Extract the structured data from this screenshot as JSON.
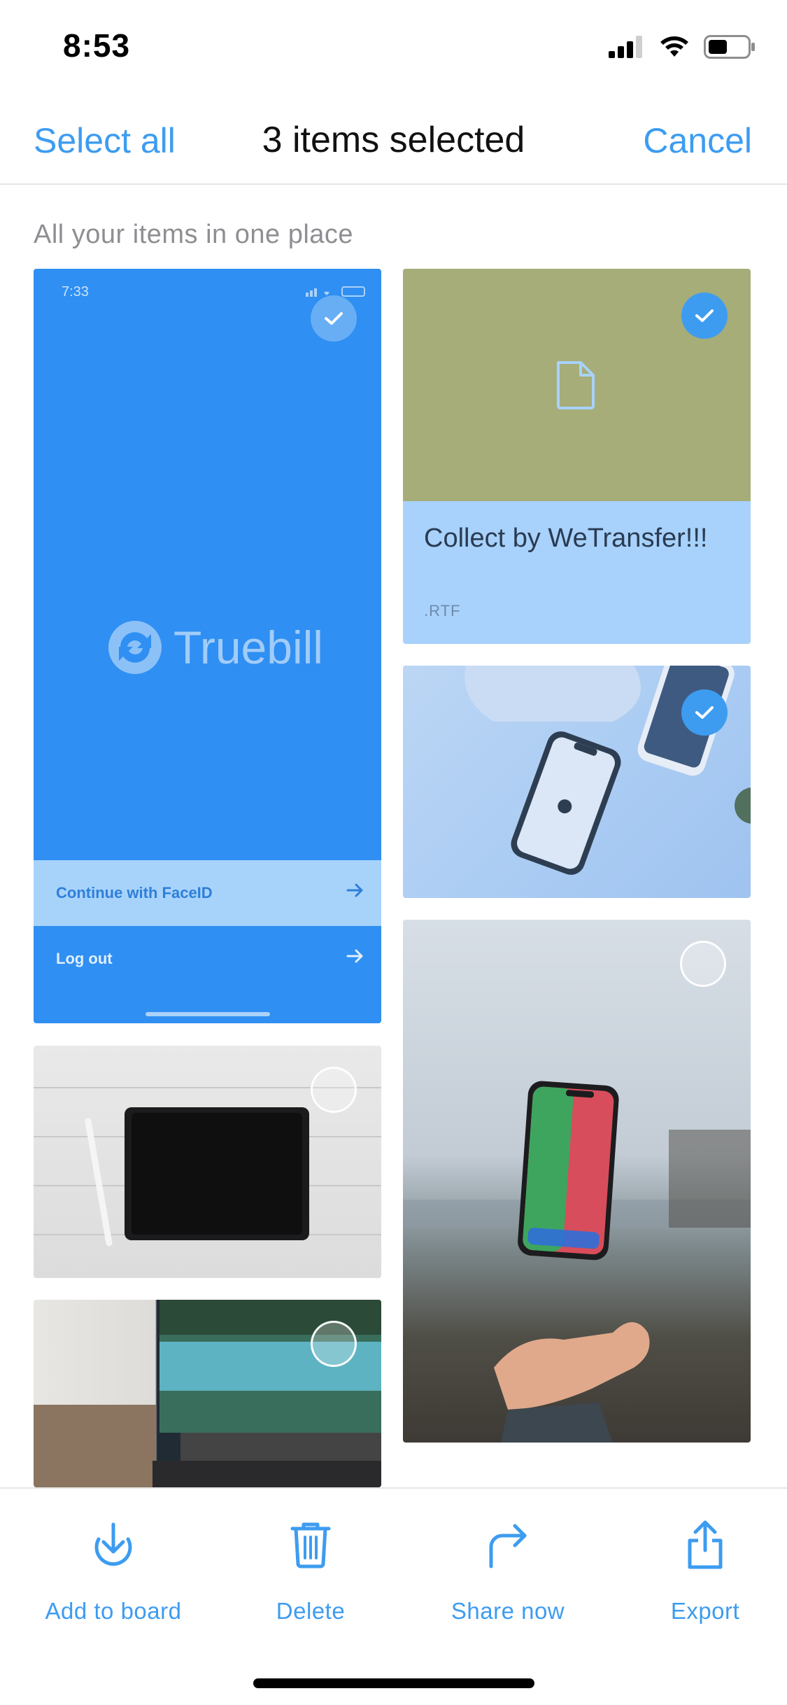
{
  "status_bar": {
    "time": "8:53"
  },
  "nav": {
    "select_all": "Select all",
    "title": "3 items selected",
    "cancel": "Cancel"
  },
  "caption": "All your items in one place",
  "tiles": {
    "truebill": {
      "time": "7:33",
      "brand": "Truebill",
      "row1": "Continue with FaceID",
      "row2": "Log out",
      "selected": true
    },
    "rtf": {
      "title": "Collect by WeTransfer!!!",
      "extension": ".RTF",
      "selected": true
    },
    "phones": {
      "selected": true
    },
    "floating_phone": {
      "selected": false
    },
    "ipad": {
      "selected": false
    },
    "macbook": {
      "selected": false
    }
  },
  "toolbar": {
    "add_to_board": "Add to board",
    "delete": "Delete",
    "share_now": "Share now",
    "export": "Export"
  },
  "colors": {
    "accent": "#3d9cf0",
    "truebill_blue": "#2f8ff2",
    "rtf_olive": "#a6ad79",
    "rtf_light_blue": "#a8d2fb"
  }
}
